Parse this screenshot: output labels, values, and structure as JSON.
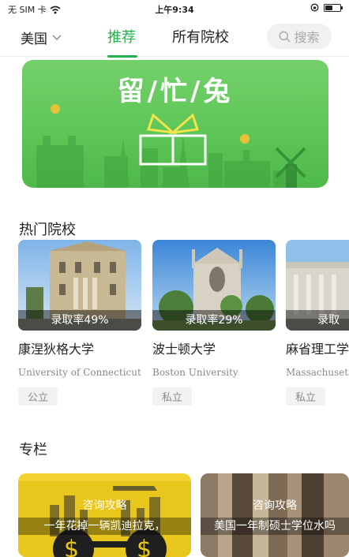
{
  "status_bar": {
    "carrier": "无 SIM 卡",
    "time": "上午9:34"
  },
  "nav": {
    "country": "美国",
    "tabs": [
      {
        "label": "推荐",
        "active": true
      },
      {
        "label": "所有院校",
        "active": false
      }
    ],
    "search_label": "搜索",
    "accent_color": "#22b24c"
  },
  "banner": {
    "title": "留/忙/兔"
  },
  "sections": {
    "hot_schools": "热门院校",
    "column": "专栏"
  },
  "schools": [
    {
      "rate": "录取率49%",
      "name_cn": "康涅狄格大学",
      "name_en": "University of Connecticut",
      "type": "公立"
    },
    {
      "rate": "录取率29%",
      "name_cn": "波士顿大学",
      "name_en": "Boston University",
      "type": "私立"
    },
    {
      "rate": "录取",
      "name_cn": "麻省理工学",
      "name_en": "Massachuset",
      "type": "私立"
    }
  ],
  "articles": [
    {
      "category": "咨询攻略",
      "title": "一年花掉一辆凯迪拉克，"
    },
    {
      "category": "咨询攻略",
      "title": "美国一年制硕士学位水吗"
    }
  ]
}
